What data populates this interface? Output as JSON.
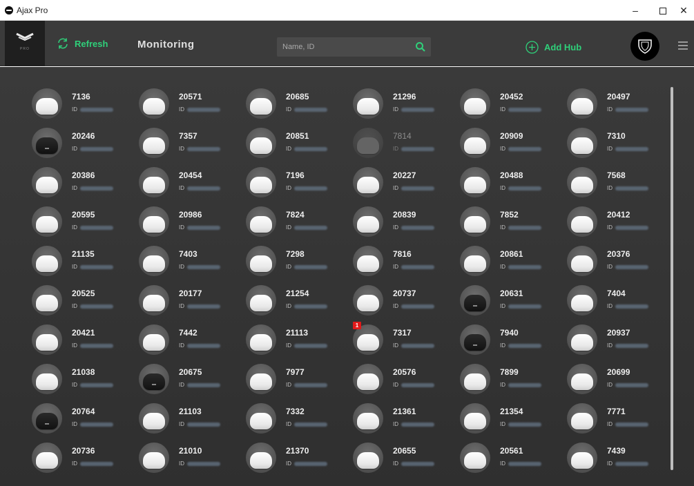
{
  "window": {
    "title": "Ajax Pro",
    "minimize": "–",
    "maximize": "",
    "close": "✕"
  },
  "header": {
    "logo_sub": "PRO",
    "refresh_label": "Refresh",
    "page_title": "Monitoring",
    "search_placeholder": "Name, ID",
    "add_hub_label": "Add Hub"
  },
  "colors": {
    "accent": "#2fd07a",
    "header_bg": "#3b3b3b",
    "content_bg": "#333333",
    "badge": "#e01a1a"
  },
  "id_label": "ID",
  "hubs": [
    {
      "name": "7136",
      "variant": "white"
    },
    {
      "name": "20571",
      "variant": "white"
    },
    {
      "name": "20685",
      "variant": "white"
    },
    {
      "name": "21296",
      "variant": "white"
    },
    {
      "name": "20452",
      "variant": "white"
    },
    {
      "name": "20497",
      "variant": "white"
    },
    {
      "name": "20246",
      "variant": "black"
    },
    {
      "name": "7357",
      "variant": "white"
    },
    {
      "name": "20851",
      "variant": "white"
    },
    {
      "name": "7814",
      "variant": "offline"
    },
    {
      "name": "20909",
      "variant": "white"
    },
    {
      "name": "7310",
      "variant": "white"
    },
    {
      "name": "20386",
      "variant": "white"
    },
    {
      "name": "20454",
      "variant": "white"
    },
    {
      "name": "7196",
      "variant": "white"
    },
    {
      "name": "20227",
      "variant": "white"
    },
    {
      "name": "20488",
      "variant": "white"
    },
    {
      "name": "7568",
      "variant": "white"
    },
    {
      "name": "20595",
      "variant": "white"
    },
    {
      "name": "20986",
      "variant": "white"
    },
    {
      "name": "7824",
      "variant": "white"
    },
    {
      "name": "20839",
      "variant": "white"
    },
    {
      "name": "7852",
      "variant": "white"
    },
    {
      "name": "20412",
      "variant": "white"
    },
    {
      "name": "21135",
      "variant": "white"
    },
    {
      "name": "7403",
      "variant": "white"
    },
    {
      "name": "7298",
      "variant": "white"
    },
    {
      "name": "7816",
      "variant": "white"
    },
    {
      "name": "20861",
      "variant": "white"
    },
    {
      "name": "20376",
      "variant": "white"
    },
    {
      "name": "20525",
      "variant": "white"
    },
    {
      "name": "20177",
      "variant": "white"
    },
    {
      "name": "21254",
      "variant": "white"
    },
    {
      "name": "20737",
      "variant": "white"
    },
    {
      "name": "20631",
      "variant": "black"
    },
    {
      "name": "7404",
      "variant": "white"
    },
    {
      "name": "20421",
      "variant": "white"
    },
    {
      "name": "7442",
      "variant": "white"
    },
    {
      "name": "21113",
      "variant": "white"
    },
    {
      "name": "7317",
      "variant": "white",
      "badge": "1"
    },
    {
      "name": "7940",
      "variant": "black"
    },
    {
      "name": "20937",
      "variant": "white"
    },
    {
      "name": "21038",
      "variant": "white"
    },
    {
      "name": "20675",
      "variant": "black"
    },
    {
      "name": "7977",
      "variant": "white"
    },
    {
      "name": "20576",
      "variant": "white"
    },
    {
      "name": "7899",
      "variant": "white"
    },
    {
      "name": "20699",
      "variant": "white"
    },
    {
      "name": "20764",
      "variant": "black"
    },
    {
      "name": "21103",
      "variant": "white"
    },
    {
      "name": "7332",
      "variant": "white"
    },
    {
      "name": "21361",
      "variant": "white"
    },
    {
      "name": "21354",
      "variant": "white"
    },
    {
      "name": "7771",
      "variant": "white"
    },
    {
      "name": "20736",
      "variant": "white"
    },
    {
      "name": "21010",
      "variant": "white"
    },
    {
      "name": "21370",
      "variant": "white"
    },
    {
      "name": "20655",
      "variant": "white"
    },
    {
      "name": "20561",
      "variant": "white"
    },
    {
      "name": "7439",
      "variant": "white"
    }
  ]
}
